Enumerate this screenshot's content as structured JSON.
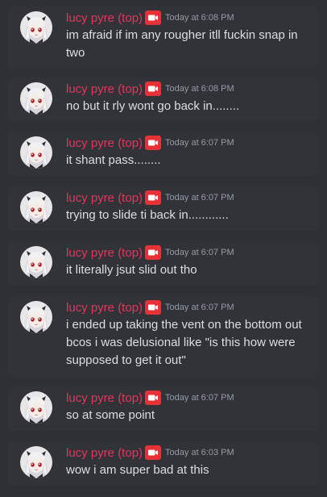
{
  "messages": [
    {
      "author": "lucy pyre (top)",
      "timestamp": "Today at 6:08 PM",
      "text": "im afraid if im any rougher itll fuckin snap in two"
    },
    {
      "author": "lucy pyre (top)",
      "timestamp": "Today at 6:08 PM",
      "text": "no but it rly wont go back in........"
    },
    {
      "author": "lucy pyre (top)",
      "timestamp": "Today at 6:07 PM",
      "text": "it shant pass........"
    },
    {
      "author": "lucy pyre (top)",
      "timestamp": "Today at 6:07 PM",
      "text": "trying to slide ti back in............"
    },
    {
      "author": "lucy pyre (top)",
      "timestamp": "Today at 6:07 PM",
      "text": "it literally jsut slid out tho"
    },
    {
      "author": "lucy pyre (top)",
      "timestamp": "Today at 6:07 PM",
      "text": "i ended up taking the vent on the bottom out bcos i was delusional like \"is this how were supposed to get it out\""
    },
    {
      "author": "lucy pyre (top)",
      "timestamp": "Today at 6:07 PM",
      "text": "so at some point"
    },
    {
      "author": "lucy pyre (top)",
      "timestamp": "Today at 6:03 PM",
      "text": "wow i am super bad at this"
    }
  ],
  "colors": {
    "background": "#2e3035",
    "message_background": "#313338",
    "username": "#e2365c",
    "badge": "#e43236",
    "timestamp": "#949ba4",
    "text": "#dbdee1"
  },
  "icons": {
    "avatar": "anime-girl-avatar",
    "badge": "video-camera-icon"
  }
}
